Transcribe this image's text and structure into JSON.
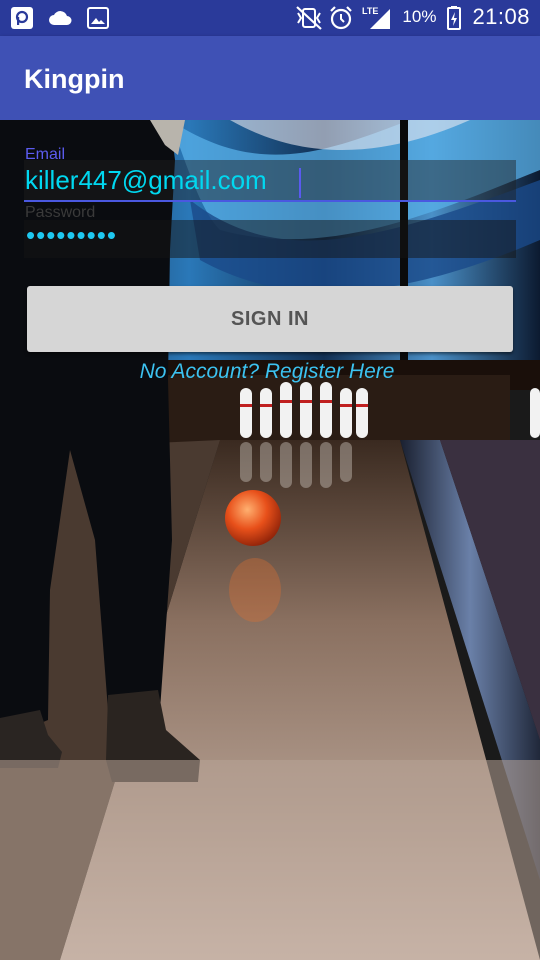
{
  "status_bar": {
    "time": "21:08",
    "battery": "10%",
    "network": "LTE",
    "left_icons": [
      "notification-icon",
      "cloud-icon",
      "image-icon"
    ],
    "right_icons": [
      "vibrate-mute-icon",
      "alarm-icon",
      "signal-icon",
      "battery-icon"
    ]
  },
  "app_bar": {
    "title": "Kingpin"
  },
  "form": {
    "email_label": "Email",
    "email_value": "killer447@gmail.com",
    "password_label": "Password",
    "password_value": "•••••••••",
    "sign_in_label": "SIGN IN",
    "register_link": "No Account? Register Here"
  },
  "colors": {
    "status_bar": "#2a3a9a",
    "app_bar": "#3f51b5",
    "accent": "#5c5cf0",
    "input_text": "#00d8f0",
    "link": "#3cc2f0"
  }
}
